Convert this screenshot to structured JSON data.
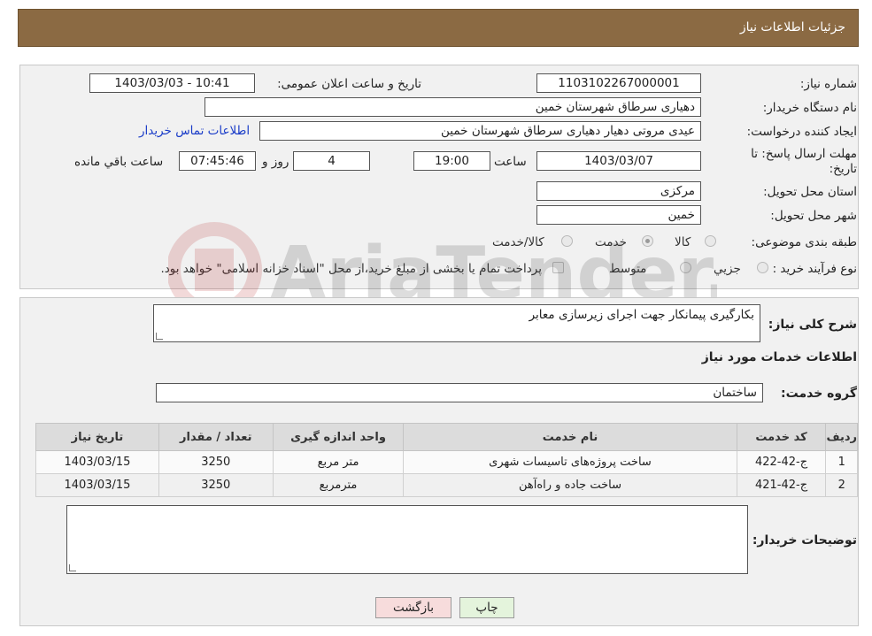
{
  "header": {
    "title": "جزئیات اطلاعات نیاز"
  },
  "form": {
    "need_number_label": "شماره نیاز:",
    "need_number": "1103102267000001",
    "announce_label": "تاریخ و ساعت اعلان عمومی:",
    "announce_value": "1403/03/03 - 10:41",
    "buyer_org_label": "نام دستگاه خریدار:",
    "buyer_org": "دهیاری سرطاق شهرستان خمین",
    "creator_label": "ایجاد کننده درخواست:",
    "creator": "عیدی مروتی دهیار دهیاری سرطاق شهرستان خمین",
    "contact_link": "اطلاعات تماس خریدار",
    "deadline_label_1": "مهلت ارسال پاسخ: تا",
    "deadline_label_2": "تاریخ:",
    "deadline_date": "1403/03/07",
    "time_label": "ساعت",
    "deadline_time": "19:00",
    "days_value": "4",
    "days_label": "روز و",
    "remaining_time": "07:45:46",
    "remaining_label": "ساعت باقي مانده",
    "province_label": "استان محل تحویل:",
    "province": "مرکزی",
    "city_label": "شهر محل تحویل:",
    "city": "خمین",
    "category_label": "طبقه بندی موضوعی:",
    "category_options": [
      "کالا",
      "خدمت",
      "کالا/خدمت"
    ],
    "category_selected": "خدمت",
    "process_label": "نوع فرآیند خرید :",
    "process_options": [
      "جزیي",
      "متوسط"
    ],
    "payment_note": "پرداخت تمام یا بخشی از مبلغ خرید،از محل \"اسناد خزانه اسلامی\" خواهد بود."
  },
  "details": {
    "summary_label": "شرح کلی نیاز:",
    "summary": "بکارگیری پیمانکار جهت اجرای زیرسازی معابر",
    "services_title": "اطلاعات خدمات مورد نیاز",
    "service_group_label": "گروه خدمت:",
    "service_group": "ساختمان",
    "table": {
      "headers": [
        "ردیف",
        "کد خدمت",
        "نام خدمت",
        "واحد اندازه گیری",
        "تعداد / مقدار",
        "تاریخ نیاز"
      ],
      "rows": [
        [
          "1",
          "ج-42-422",
          "ساخت پروژه‌های تاسیسات شهری",
          "متر مربع",
          "3250",
          "1403/03/15"
        ],
        [
          "2",
          "ج-42-421",
          "ساخت جاده و راه‌آهن",
          "مترمربع",
          "3250",
          "1403/03/15"
        ]
      ]
    },
    "buyer_notes_label": "توضیحات خریدار:",
    "buyer_notes": ""
  },
  "buttons": {
    "print": "چاپ",
    "back": "بازگشت"
  },
  "watermark": "AriaTender.neT",
  "colors": {
    "header_bg": "#8b6a43",
    "link": "#1a3cc8",
    "back_button_bg": "#f7dcdc",
    "print_button_bg": "#e4f4dc"
  }
}
